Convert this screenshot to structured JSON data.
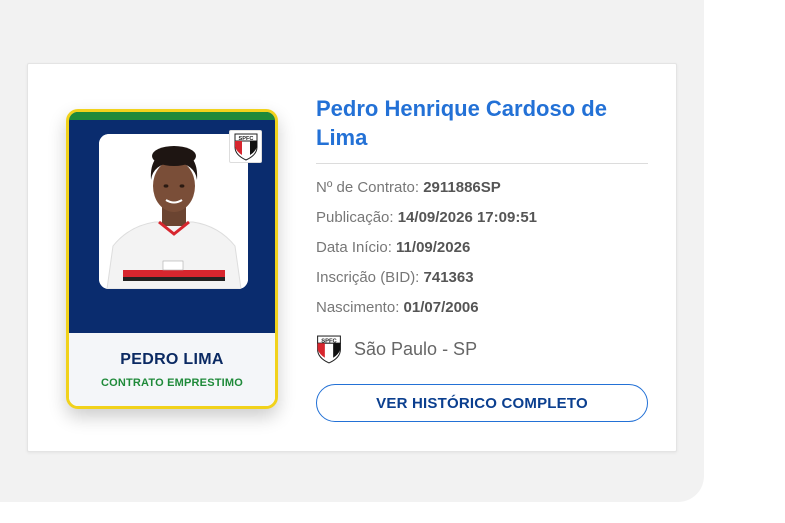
{
  "player_card": {
    "name": "PEDRO LIMA",
    "status": "CONTRATO EMPRESTIMO",
    "photo_alt": "Foto do jogador",
    "badge_text": "SPFC"
  },
  "details": {
    "full_name": "Pedro Henrique Cardoso de Lima",
    "rows": [
      {
        "label": "Nº de Contrato: ",
        "value": "2911886SP"
      },
      {
        "label": "Publicação: ",
        "value": "14/09/2026 17:09:51"
      },
      {
        "label": "Data Início: ",
        "value": "11/09/2026"
      },
      {
        "label": "Inscrição (BID): ",
        "value": "741363"
      },
      {
        "label": "Nascimento: ",
        "value": "01/07/2006"
      }
    ],
    "club": "São Paulo - SP"
  },
  "actions": {
    "history_label": "VER HISTÓRICO COMPLETO"
  },
  "colors": {
    "accent_blue": "#2371d6",
    "navy": "#0a2c6e",
    "card_border": "#f1d21c",
    "green": "#1f8a3a"
  }
}
